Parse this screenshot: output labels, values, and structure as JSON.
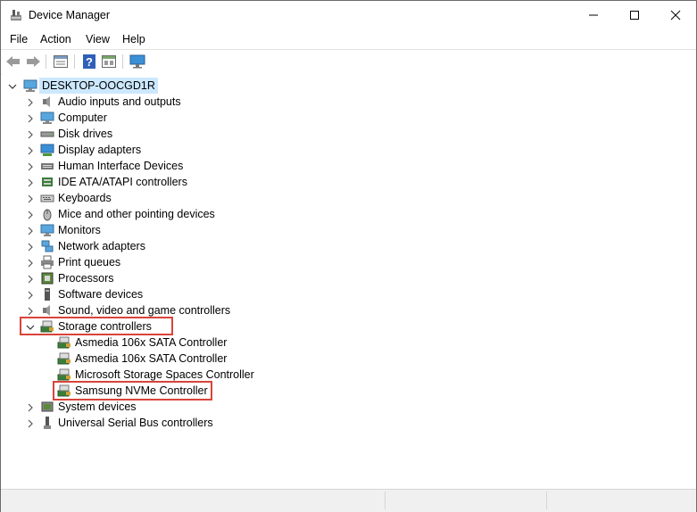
{
  "window": {
    "title": "Device Manager",
    "controls": {
      "minimize": "minimize",
      "maximize": "maximize",
      "close": "close"
    }
  },
  "menu": [
    "File",
    "Action",
    "View",
    "Help"
  ],
  "toolbar": [
    {
      "name": "back-icon"
    },
    {
      "name": "forward-icon"
    },
    {
      "name": "properties-icon"
    },
    {
      "name": "help-icon"
    },
    {
      "name": "show-hidden-icon"
    },
    {
      "name": "monitor-scan-icon"
    }
  ],
  "tree": {
    "root": "DESKTOP-OOCGD1R",
    "categories": [
      {
        "label": "Audio inputs and outputs",
        "icon": "speaker-icon"
      },
      {
        "label": "Computer",
        "icon": "computer-icon"
      },
      {
        "label": "Disk drives",
        "icon": "disk-drive-icon"
      },
      {
        "label": "Display adapters",
        "icon": "display-adapter-icon"
      },
      {
        "label": "Human Interface Devices",
        "icon": "hid-icon"
      },
      {
        "label": "IDE ATA/ATAPI controllers",
        "icon": "ide-controller-icon"
      },
      {
        "label": "Keyboards",
        "icon": "keyboard-icon"
      },
      {
        "label": "Mice and other pointing devices",
        "icon": "mouse-icon"
      },
      {
        "label": "Monitors",
        "icon": "monitor-icon"
      },
      {
        "label": "Network adapters",
        "icon": "network-adapter-icon"
      },
      {
        "label": "Print queues",
        "icon": "printer-icon"
      },
      {
        "label": "Processors",
        "icon": "processor-icon"
      },
      {
        "label": "Software devices",
        "icon": "software-device-icon"
      },
      {
        "label": "Sound, video and game controllers",
        "icon": "sound-icon"
      }
    ],
    "expanded": {
      "label": "Storage controllers",
      "icon": "storage-controller-icon",
      "children": [
        "Asmedia 106x SATA Controller",
        "Asmedia 106x SATA Controller",
        "Microsoft Storage Spaces Controller",
        "Samsung NVMe Controller"
      ]
    },
    "after": [
      {
        "label": "System devices",
        "icon": "system-device-icon"
      },
      {
        "label": "Universal Serial Bus controllers",
        "icon": "usb-icon"
      }
    ]
  },
  "colors": {
    "highlight": "#d9443a",
    "selection": "#cce8ff"
  }
}
